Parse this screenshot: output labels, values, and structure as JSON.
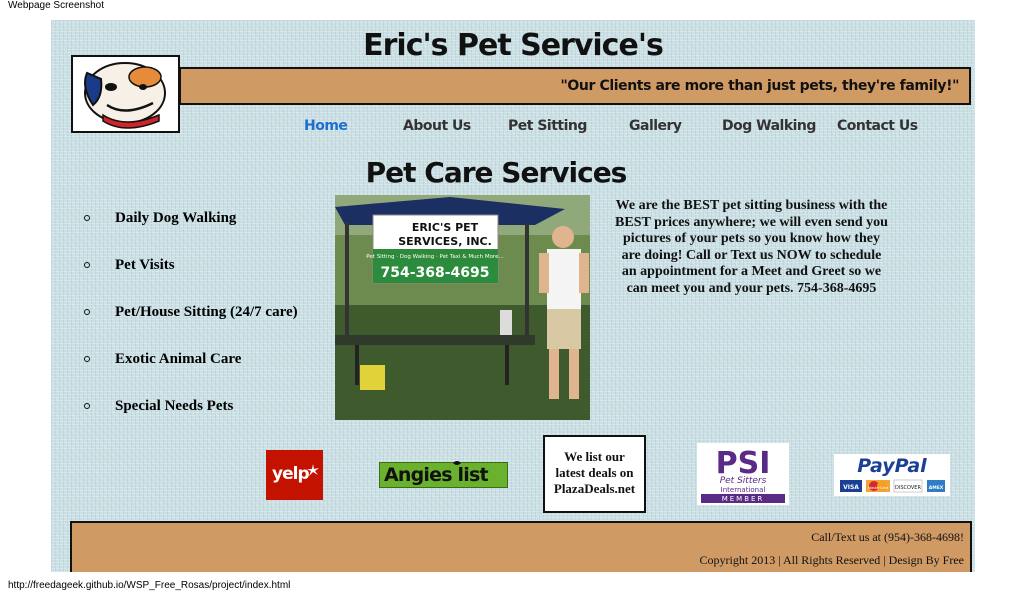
{
  "screenshot": {
    "caption": "Webpage Screenshot",
    "url": "http://freedageek.github.io/WSP_Free_Rosas/project/index.html"
  },
  "header": {
    "title": "Eric's Pet Service's",
    "tagline": "\"Our Clients are more than just pets, they're family!\""
  },
  "nav": {
    "items": [
      {
        "label": "Home",
        "active": true
      },
      {
        "label": "About Us"
      },
      {
        "label": "Pet Sitting"
      },
      {
        "label": "Gallery"
      },
      {
        "label": "Dog Walking"
      },
      {
        "label": "Contact Us"
      }
    ]
  },
  "main": {
    "heading": "Pet Care Services",
    "services": [
      "Daily Dog Walking",
      "Pet Visits",
      "Pet/House Sitting (24/7 care)",
      "Exotic Animal Care",
      "Special Needs Pets"
    ],
    "photo": {
      "banner_line1": "ERIC'S PET",
      "banner_line2": "SERVICES, INC.",
      "banner_services": "Pet Sitting · Dog Walking · Pet Taxi & Much More...",
      "banner_phone": "754-368-4695"
    },
    "blurb": "We are the BEST pet sitting business with the BEST prices anywhere; we will even send you pictures of your pets so you know how they are doing! Call or Text us NOW to schedule an appointment for a Meet and Greet so we can meet you and your pets. 754-368-4695"
  },
  "badges": {
    "yelp": "yelp",
    "angies": "Angies list",
    "plaza": "We list our\nlatest deals on\nPlazaDeals.net",
    "psi_big": "PSI",
    "psi_sub1": "Pet Sitters",
    "psi_sub2": "International",
    "psi_member": "MEMBER",
    "paypal": "PayPal",
    "cards": [
      "VISA",
      "MasterCard",
      "DISCOVER",
      "AMEX"
    ]
  },
  "footer": {
    "line1": "Call/Text us at (954)-368-4698!",
    "line2": "Copyright 2013 | All Rights Reserved | Design By Free"
  },
  "colors": {
    "background": "#c9dfe4",
    "accent_bar": "#d09a64",
    "nav_active": "#1d6fd1",
    "nav_text": "#333333"
  },
  "icons": {
    "logo": "cartoon-dog-logo-icon",
    "yelp": "yelp-burst-icon",
    "angies": "angies-list-icon",
    "psi": "psi-logo-icon",
    "paypal": "paypal-logo-icon"
  }
}
